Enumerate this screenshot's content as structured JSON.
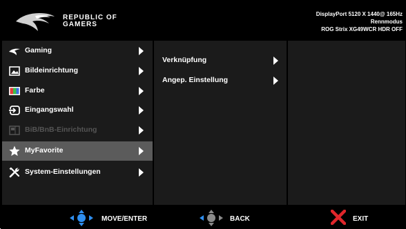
{
  "header": {
    "brand_line1": "REPUBLIC OF",
    "brand_line2": "GAMERS",
    "status_line1": "DisplayPort 5120 X 1440@ 165Hz",
    "status_line2": "Rennmodus",
    "status_line3": "ROG Strix XG49WCR HDR OFF"
  },
  "menu": {
    "items": [
      {
        "label": "Gaming",
        "icon": "rog-eye-icon",
        "state": "normal"
      },
      {
        "label": "Bildeinrichtung",
        "icon": "picture-icon",
        "state": "normal"
      },
      {
        "label": "Farbe",
        "icon": "color-icon",
        "state": "normal"
      },
      {
        "label": "Eingangswahl",
        "icon": "input-icon",
        "state": "normal"
      },
      {
        "label": "BiB/BnB-Einrichtung",
        "icon": "pip-icon",
        "state": "disabled"
      },
      {
        "label": "MyFavorite",
        "icon": "star-icon",
        "state": "selected"
      },
      {
        "label": "System-Einstellungen",
        "icon": "tools-icon",
        "state": "normal"
      }
    ]
  },
  "submenu": {
    "items": [
      {
        "label": "Verknüpfung"
      },
      {
        "label": "Angep. Einstellung"
      }
    ]
  },
  "footer": {
    "move_label": "MOVE/ENTER",
    "back_label": "BACK",
    "exit_label": "EXIT"
  },
  "colors": {
    "background": "#000000",
    "panel": "#1b1b1b",
    "selected": "#5b5b5b",
    "nav_blue": "#2f8ff0",
    "exit_red": "#e0262b",
    "disabled_text": "#555555"
  }
}
